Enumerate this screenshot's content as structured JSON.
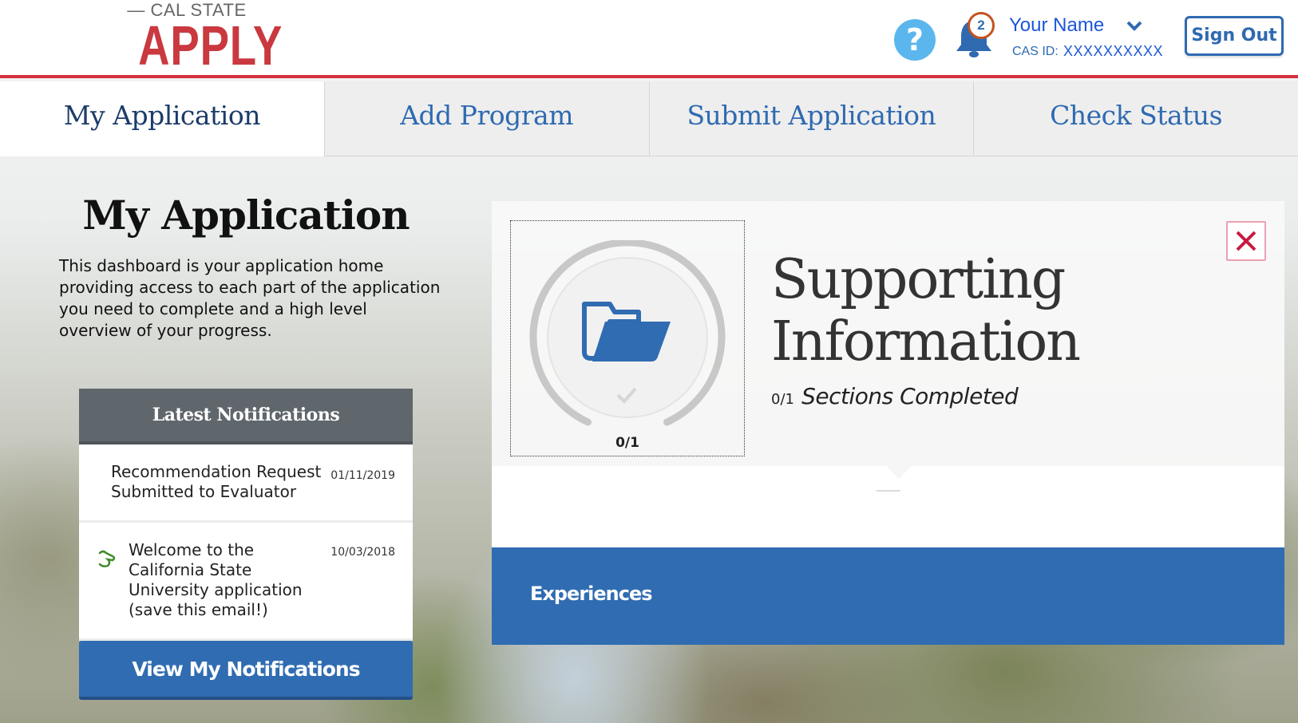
{
  "header": {
    "logo_top": "— CAL STATE —",
    "logo_main": "APPLY",
    "help_icon": "question-circle-icon",
    "notification_icon": "bell-icon",
    "notification_count": "2",
    "user_name": "Your Name",
    "user_menu_icon": "chevron-down-icon",
    "cas_id_label": "CAS ID:",
    "cas_id_value": "XXXXXXXXXX",
    "sign_out_label": "Sign Out"
  },
  "nav": {
    "tabs": [
      {
        "label": "My Application",
        "active": true
      },
      {
        "label": "Add Program",
        "active": false
      },
      {
        "label": "Submit Application",
        "active": false
      },
      {
        "label": "Check Status",
        "active": false
      }
    ]
  },
  "intro": {
    "title": "My Application",
    "description": "This dashboard is your application home providing access to each part of the application you need to complete and a high level overview of your progress."
  },
  "notifications": {
    "header": "Latest Notifications",
    "items": [
      {
        "text": "Recommendation Request Submitted to Evaluator",
        "date": "01/11/2019",
        "icon": null
      },
      {
        "text": "Welcome to the California State University application (save this email!)",
        "date": "10/03/2018",
        "icon": "welcome-hand-icon"
      }
    ],
    "view_button_label": "View My Notifications"
  },
  "section": {
    "icon": "folder-open-icon",
    "progress_completed": 0,
    "progress_total": 1,
    "progress_label": "0/1",
    "title_line1": "Supporting",
    "title_line2": "Information",
    "sub_fraction": "0/1",
    "sub_label": "Sections Completed",
    "close_icon": "close-icon",
    "subsections": [
      {
        "label": "Experiences"
      }
    ]
  },
  "colors": {
    "brand_red": "#d6303d",
    "primary_blue": "#306cb1",
    "link_blue": "#1d57d8",
    "help_blue": "#5bb6ee",
    "notif_header_gray": "#5f666c",
    "close_red": "#c8193f"
  }
}
